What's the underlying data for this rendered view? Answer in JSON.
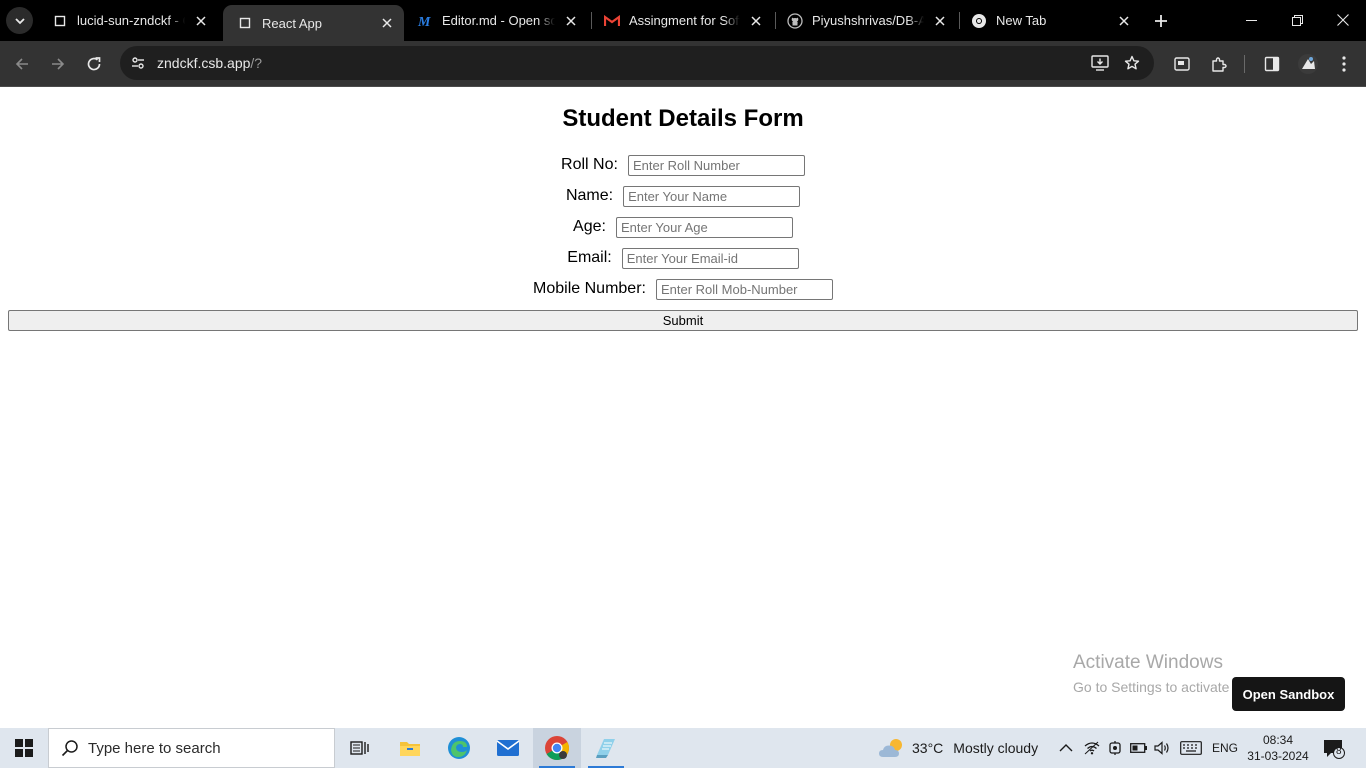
{
  "browser": {
    "tabs": [
      {
        "title": "lucid-sun-zndckf - Co",
        "icon": "codesandbox-icon",
        "active": false
      },
      {
        "title": "React App",
        "icon": "codesandbox-icon",
        "active": true
      },
      {
        "title": "Editor.md - Open sou",
        "icon": "markdown-m-icon",
        "active": false
      },
      {
        "title": "Assingment for Softw",
        "icon": "gmail-icon",
        "active": false
      },
      {
        "title": "Piyushshrivas/DB-Ass",
        "icon": "github-icon",
        "active": false
      },
      {
        "title": "New Tab",
        "icon": "chrome-icon",
        "active": false
      }
    ],
    "address": {
      "host": "zndckf.csb.app",
      "path": "/?"
    }
  },
  "form": {
    "title": "Student Details Form",
    "fields": [
      {
        "label": "Roll No:",
        "placeholder": "Enter Roll Number",
        "value": ""
      },
      {
        "label": "Name:",
        "placeholder": "Enter Your Name",
        "value": ""
      },
      {
        "label": "Age:",
        "placeholder": "Enter Your Age",
        "value": ""
      },
      {
        "label": "Email:",
        "placeholder": "Enter Your Email-id",
        "value": ""
      },
      {
        "label": "Mobile Number:",
        "placeholder": "Enter Roll Mob-Number",
        "value": ""
      }
    ],
    "submit_label": "Submit"
  },
  "watermark": {
    "line1": "Activate Windows",
    "line2": "Go to Settings to activate Windows."
  },
  "sandbox_button": "Open Sandbox",
  "taskbar": {
    "search_placeholder": "Type here to search",
    "weather_temp": "33°C",
    "weather_condition": "Mostly cloudy",
    "language": "ENG",
    "time": "08:34",
    "date": "31-03-2024",
    "notification_count": "8"
  },
  "colors": {
    "tabbar_bg": "#000000",
    "toolbar_bg": "#333333",
    "omnibox_bg": "#1f1f1f",
    "taskbar_bg": "#dfe6ee",
    "taskbar_accent": "#2c7ad6"
  }
}
